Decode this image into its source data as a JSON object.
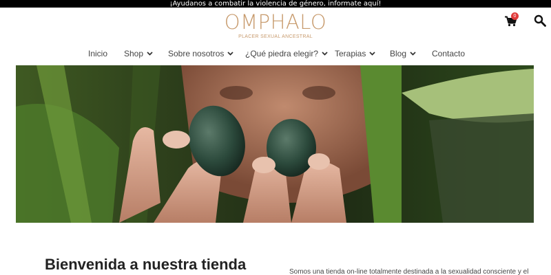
{
  "announcement": "¡Ayudanos a combatir la violencia de género, informate aquí!",
  "brand": {
    "name": "OMPHALO",
    "tagline": "PLACER SEXUAL ANCESTRAL",
    "color": "#c79a6c"
  },
  "header": {
    "cart_count": "0",
    "cart_icon": "cart-icon",
    "search_icon": "search-icon"
  },
  "nav": {
    "items": [
      {
        "label": "Inicio",
        "has_dropdown": false
      },
      {
        "label": "Shop",
        "has_dropdown": true
      },
      {
        "label": "Sobre nosotros",
        "has_dropdown": true
      },
      {
        "label": "¿Qué piedra elegir?",
        "has_dropdown": true
      },
      {
        "label": "Terapias",
        "has_dropdown": true
      },
      {
        "label": "Blog",
        "has_dropdown": true
      },
      {
        "label": "Contacto",
        "has_dropdown": false
      }
    ]
  },
  "main": {
    "welcome_heading": "Bienvenida a nuestra tienda",
    "intro_text": "Somos una tienda on-line totalmente destinada a la sexualidad consciente y el"
  }
}
